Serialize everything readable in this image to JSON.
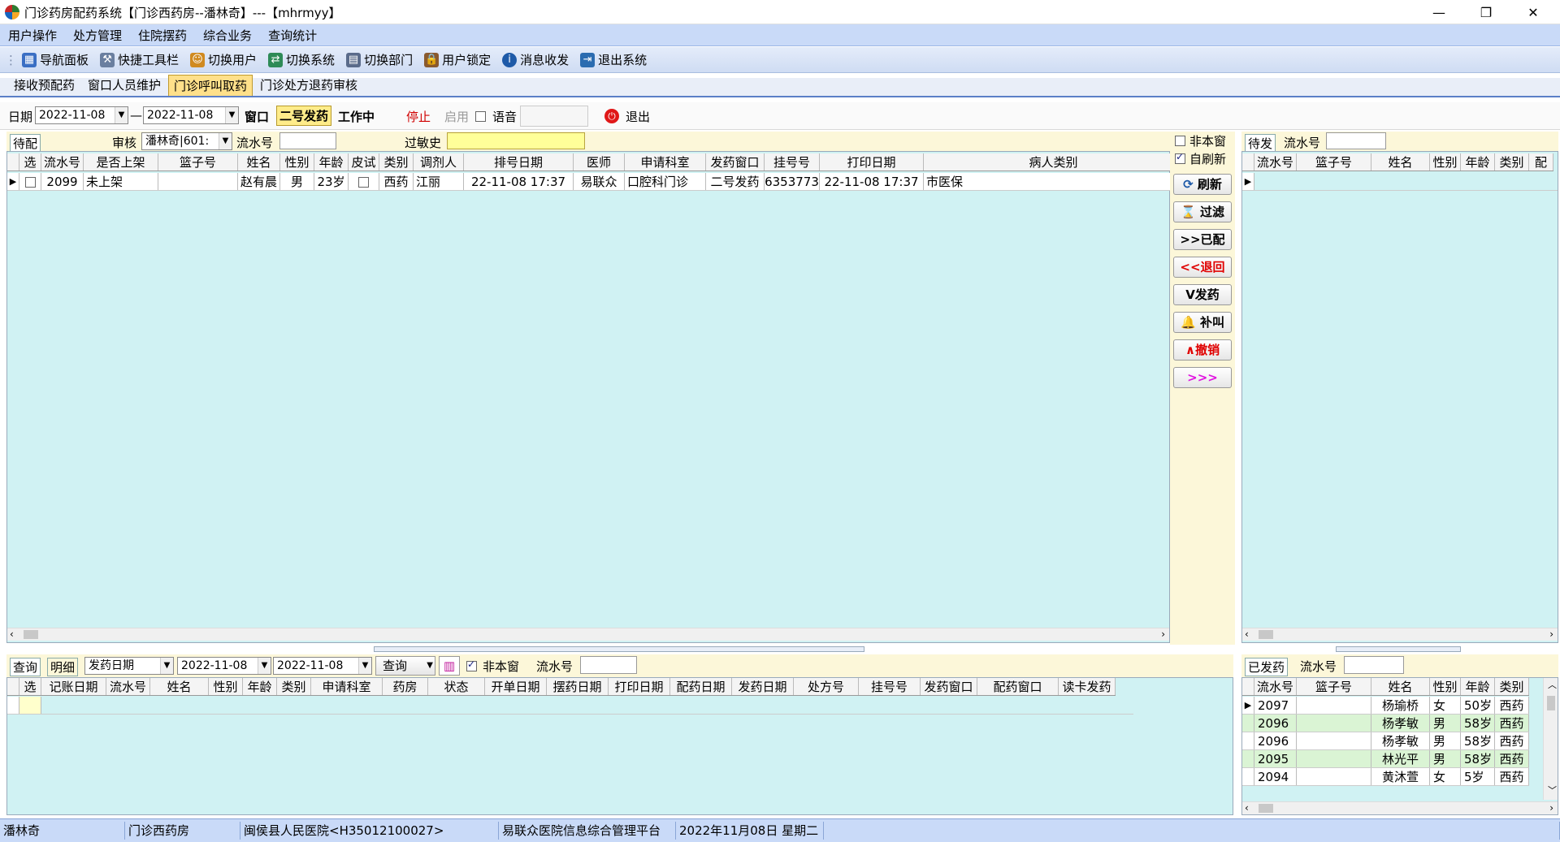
{
  "window": {
    "title": "门诊药房配药系统【门诊西药房--潘林奇】---【mhrmyy】",
    "min": "—",
    "max": "❐",
    "close": "✕"
  },
  "menu": [
    "用户操作",
    "处方管理",
    "住院摆药",
    "综合业务",
    "查询统计"
  ],
  "toolbar": [
    {
      "label": "导航面板",
      "icon": "nav-panel-icon",
      "color": "#3a6fc4"
    },
    {
      "label": "快捷工具栏",
      "icon": "tools-icon",
      "color": "#6a7fa0"
    },
    {
      "label": "切换用户",
      "icon": "switch-user-icon",
      "color": "#d08a20"
    },
    {
      "label": "切换系统",
      "icon": "switch-system-icon",
      "color": "#2e8b57"
    },
    {
      "label": "切换部门",
      "icon": "switch-dept-icon",
      "color": "#5a6b8a"
    },
    {
      "label": "用户锁定",
      "icon": "user-lock-icon",
      "color": "#8a5a2e"
    },
    {
      "label": "消息收发",
      "icon": "info-icon",
      "color": "#1e5aa8"
    },
    {
      "label": "退出系统",
      "icon": "exit-system-icon",
      "color": "#2b6cb0"
    }
  ],
  "tabs": [
    "接收预配药",
    "窗口人员维护",
    "门诊呼叫取药",
    "门诊处方退药审核"
  ],
  "filter": {
    "date_label": "日期",
    "date_from": "2022-11-08",
    "dash": "—",
    "date_to": "2022-11-08",
    "window_label": "窗口",
    "window_value": "二号发药",
    "status": "工作中",
    "stop": "停止",
    "enable": "启用",
    "voice": "语音",
    "exit": "退出"
  },
  "pending": {
    "tab": "待配",
    "review_label": "审核",
    "review_value": "潘林奇|601:",
    "serial_label": "流水号",
    "allergy_label": "过敏史",
    "columns": [
      "选",
      "流水号",
      "是否上架",
      "篮子号",
      "姓名",
      "性别",
      "年龄",
      "皮试",
      "类别",
      "调剂人",
      "排号日期",
      "医师",
      "申请科室",
      "发药窗口",
      "挂号号",
      "打印日期",
      "病人类别"
    ],
    "rows": [
      [
        "",
        "2099",
        "未上架",
        "",
        "赵有晨",
        "男",
        "23岁",
        "",
        "西药",
        "江丽",
        "22-11-08 17:37",
        "易联众",
        "口腔科门诊",
        "二号发药",
        "6353773",
        "22-11-08 17:37",
        "市医保"
      ]
    ]
  },
  "side": {
    "not_this_window": "非本窗",
    "auto_refresh": "自刷新",
    "buttons": [
      "刷新",
      "过滤",
      ">>已配",
      "<<退回",
      "V发药",
      "补叫",
      "∧撤销",
      ">>>"
    ]
  },
  "query": {
    "tab": "查询",
    "detail": "明细",
    "date_type": "发药日期",
    "date_from": "2022-11-08",
    "date_to": "2022-11-08",
    "query_btn": "查询",
    "not_this_window": "非本窗",
    "serial_label": "流水号",
    "columns": [
      "选",
      "记账日期",
      "流水号",
      "姓名",
      "性别",
      "年龄",
      "类别",
      "申请科室",
      "药房",
      "状态",
      "开单日期",
      "摆药日期",
      "打印日期",
      "配药日期",
      "发药日期",
      "处方号",
      "挂号号",
      "发药窗口",
      "配药窗口",
      "读卡发药"
    ]
  },
  "waiting": {
    "tab": "待发",
    "serial_label": "流水号",
    "columns": [
      "流水号",
      "篮子号",
      "姓名",
      "性别",
      "年龄",
      "类别",
      "配"
    ]
  },
  "dispensed": {
    "tab": "已发药",
    "serial_label": "流水号",
    "columns": [
      "流水号",
      "篮子号",
      "姓名",
      "性别",
      "年龄",
      "类别"
    ],
    "rows": [
      [
        "2097",
        "",
        "杨瑜桥",
        "女",
        "50岁",
        "西药"
      ],
      [
        "2096",
        "",
        "杨孝敏",
        "男",
        "58岁",
        "西药"
      ],
      [
        "2096",
        "",
        "杨孝敏",
        "男",
        "58岁",
        "西药"
      ],
      [
        "2095",
        "",
        "林光平",
        "男",
        "58岁",
        "西药"
      ],
      [
        "2094",
        "",
        "黄沐萱",
        "女",
        "5岁",
        "西药"
      ]
    ]
  },
  "status": [
    "潘林奇",
    "门诊西药房",
    "闽侯县人民医院<H35012100027>",
    "易联众医院信息综合管理平台",
    "2022年11月08日 星期二",
    ""
  ]
}
